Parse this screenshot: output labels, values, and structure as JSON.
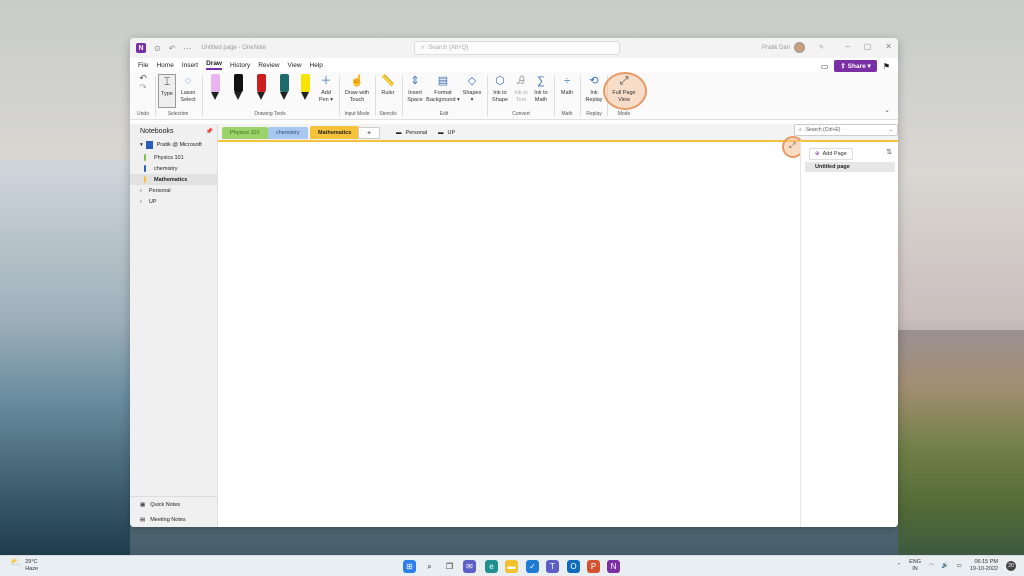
{
  "app": {
    "doc_title": "Untitled page",
    "app_name": "OneNote",
    "search_placeholder": "Search (Alt+Q)",
    "user_name": "Pratik Dan"
  },
  "menu": {
    "items": [
      "File",
      "Home",
      "Insert",
      "Draw",
      "History",
      "Review",
      "View",
      "Help"
    ],
    "active": "Draw",
    "share_label": "Share"
  },
  "ribbon": {
    "undo": "Undo",
    "type": "Type",
    "lasso": "Lasso Select",
    "add_pen": "Add Pen",
    "draw_touch": "Draw with Touch",
    "ruler": "Ruler",
    "insert_space": "Insert Space",
    "format_bg": "Format Background",
    "shapes": "Shapes",
    "ink_shape": "Ink to Shape",
    "ink_text": "Ink to Text",
    "ink_math": "Ink to Math",
    "math": "Math",
    "ink_replay": "Ink Replay",
    "full_page": "Full Page View",
    "groups": {
      "undo": "Undo",
      "selection": "Selection",
      "drawing_tools": "Drawing Tools",
      "input_mode": "Input Mode",
      "stencils": "Stencils",
      "edit": "Edit",
      "convert": "Convert",
      "math": "Math",
      "replay": "Replay",
      "mode": "Mode"
    },
    "pen_colors": [
      "#e8b4f0",
      "#111111",
      "#cc1f1f",
      "#1f6b6b",
      "#f5e400"
    ]
  },
  "notebooks": {
    "title": "Notebooks",
    "account": "Pratik @ Microsoft",
    "sections": [
      {
        "label": "Physics 101",
        "color": "#7cc242"
      },
      {
        "label": "chemistry",
        "color": "#2b5fb3"
      },
      {
        "label": "Mathematics",
        "color": "#f5c23a"
      }
    ],
    "groups": [
      "Personal",
      "UP"
    ],
    "quick_notes": "Quick Notes",
    "meeting_notes": "Meeting Notes"
  },
  "tabs": {
    "sections": [
      {
        "label": "Physics 101",
        "color": "#9bd36a"
      },
      {
        "label": "chemistry",
        "color": "#a9c7ee"
      },
      {
        "label": "Mathematics",
        "color": "#f5c23a"
      }
    ],
    "add": "+",
    "groups": [
      "Personal",
      "UP"
    ]
  },
  "pages": {
    "search_placeholder": "Search (Ctrl+E)",
    "add_page": "Add Page",
    "items": [
      "Untitled page"
    ]
  },
  "taskbar": {
    "temp": "29°C",
    "condition": "Haze",
    "lang": "ENG",
    "region": "IN",
    "time": "06:15 PM",
    "date": "19-10-2022",
    "notif_count": "20"
  }
}
